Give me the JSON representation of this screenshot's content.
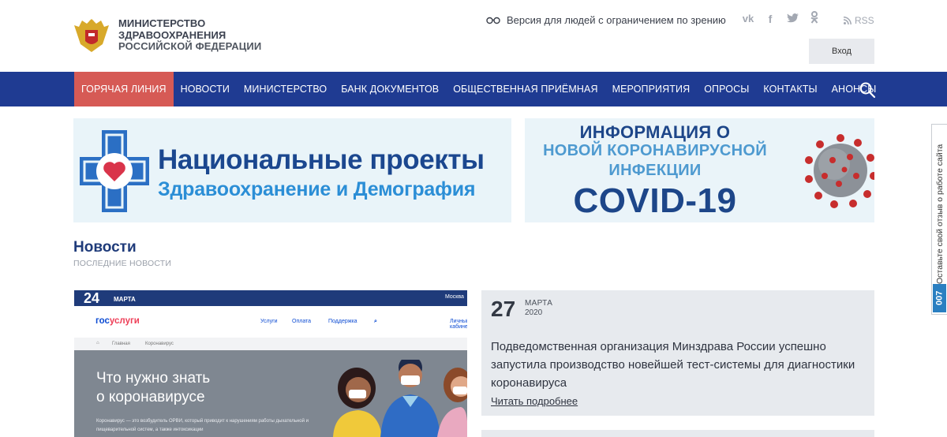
{
  "header": {
    "org_line1": "МИНИСТЕРСТВО",
    "org_line2": "ЗДРАВООХРАНЕНИЯ",
    "org_line3": "РОССИЙСКОЙ ФЕДЕРАЦИИ",
    "vision_label": "Версия для людей с ограничением по зрению",
    "social": [
      "vk",
      "f",
      "twitter",
      "ok"
    ],
    "rss_label": "RSS",
    "login_label": "Вход"
  },
  "nav": {
    "items": [
      {
        "label": "ГОРЯЧАЯ ЛИНИЯ",
        "active": true
      },
      {
        "label": "НОВОСТИ"
      },
      {
        "label": "МИНИСТЕРСТВО"
      },
      {
        "label": "БАНК ДОКУМЕНТОВ"
      },
      {
        "label": "ОБЩЕСТВЕННАЯ ПРИЁМНАЯ"
      },
      {
        "label": "МЕРОПРИЯТИЯ"
      },
      {
        "label": "ОПРОСЫ"
      },
      {
        "label": "КОНТАКТЫ"
      },
      {
        "label": "АНОНСЫ"
      }
    ],
    "search_icon": "search-icon"
  },
  "banners": {
    "national": {
      "title": "Национальные проекты",
      "subtitle": "Здравоохранение и Демография"
    },
    "covid": {
      "line1": "ИНФОРМАЦИЯ О",
      "line2": "НОВОЙ КОРОНАВИРУСНОЙ",
      "line3": "ИНФЕКЦИИ",
      "line4": "COVID-19"
    }
  },
  "news": {
    "title": "Новости",
    "subtitle": "ПОСЛЕДНИЕ НОВОСТИ",
    "screenshot": {
      "day": "24",
      "month": "МАРТА",
      "city": "Москва",
      "logo_a": "гос",
      "logo_b": "услуги",
      "links": [
        "Услуги",
        "Оплата",
        "Поддержка",
        "Личный кабинет"
      ],
      "crumb_home": "Главная",
      "crumb_page": "Коронавирус",
      "heading_line1": "Что нужно знать",
      "heading_line2": "о коронавирусе",
      "body": "Коронавирус — это возбудитель ОРВИ, который приводит к нарушениям работы дыхательной и пищеварительной систем, а также интоксикации"
    },
    "card": {
      "day": "27",
      "month": "МАРТА",
      "year": "2020",
      "text": "Подведомственная организация Минздрава России успешно запустила производство новейшей тест-системы для диагностики коронавируса",
      "more": "Читать подробнее"
    }
  },
  "feedback": {
    "text": "Оставьте свой отзыв о работе сайта",
    "badge": "007"
  }
}
